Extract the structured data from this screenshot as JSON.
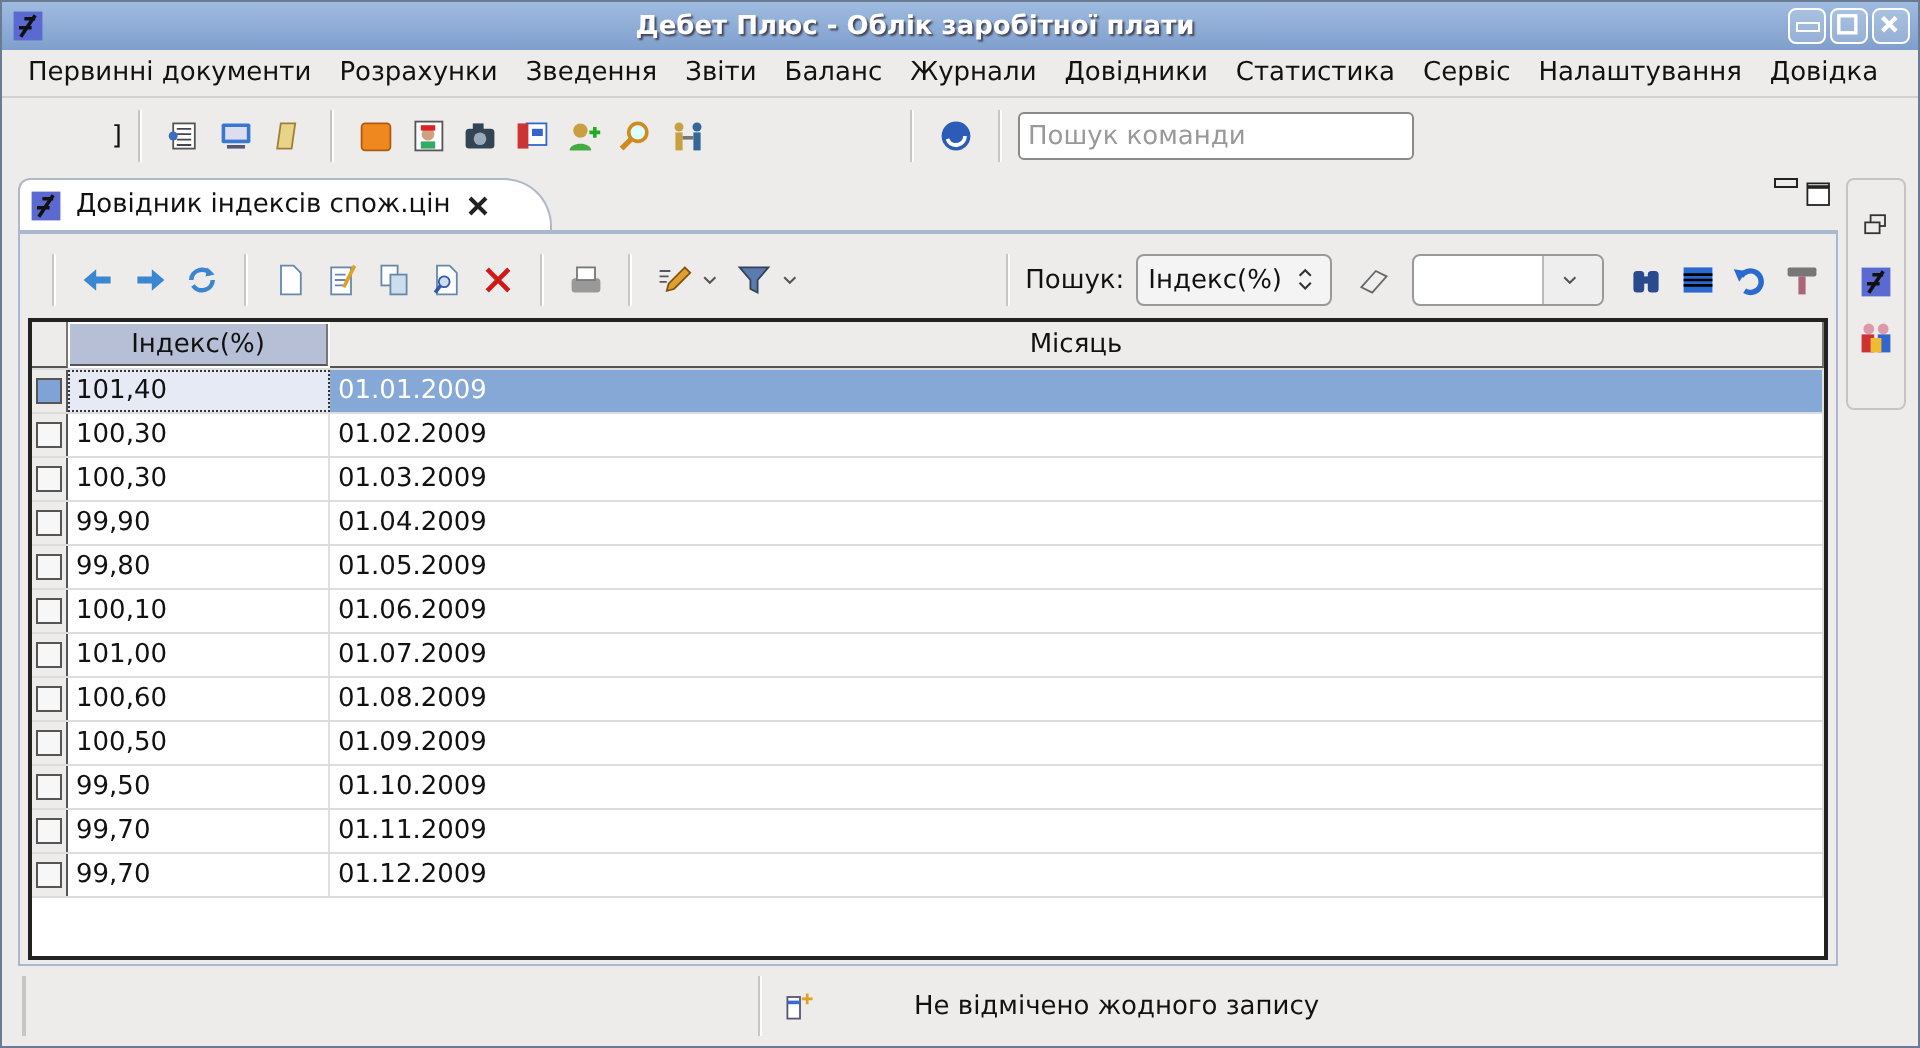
{
  "window": {
    "title": "Дебет Плюс - Облік заробітної плати"
  },
  "menu": [
    "Первинні документи",
    "Розрахунки",
    "Зведення",
    "Звіти",
    "Баланс",
    "Журнали",
    "Довідники",
    "Статистика",
    "Сервіс",
    "Налаштування",
    "Довідка"
  ],
  "toolbar": {
    "fragment": "]",
    "search": {
      "placeholder": "Пошук команди"
    }
  },
  "tab": {
    "label": "Довідник індексів спож.цін",
    "selected": true
  },
  "view_toolbar": {
    "search_label": "Пошук:",
    "search_field": "Індекс(%)"
  },
  "table": {
    "columns": [
      {
        "label": "Індекс(%)",
        "selected": true
      },
      {
        "label": "Місяць",
        "selected": false
      }
    ],
    "rows": [
      {
        "index": "101,40",
        "month": "01.01.2009",
        "selected": true
      },
      {
        "index": "100,30",
        "month": "01.02.2009",
        "selected": false
      },
      {
        "index": "100,30",
        "month": "01.03.2009",
        "selected": false
      },
      {
        "index": "99,90",
        "month": "01.04.2009",
        "selected": false
      },
      {
        "index": "99,80",
        "month": "01.05.2009",
        "selected": false
      },
      {
        "index": "100,10",
        "month": "01.06.2009",
        "selected": false
      },
      {
        "index": "101,00",
        "month": "01.07.2009",
        "selected": false
      },
      {
        "index": "100,60",
        "month": "01.08.2009",
        "selected": false
      },
      {
        "index": "100,50",
        "month": "01.09.2009",
        "selected": false
      },
      {
        "index": "99,50",
        "month": "01.10.2009",
        "selected": false
      },
      {
        "index": "99,70",
        "month": "01.11.2009",
        "selected": false
      },
      {
        "index": "99,70",
        "month": "01.12.2009",
        "selected": false
      }
    ]
  },
  "status_bar": {
    "message": "Не відмічено жодного запису"
  }
}
